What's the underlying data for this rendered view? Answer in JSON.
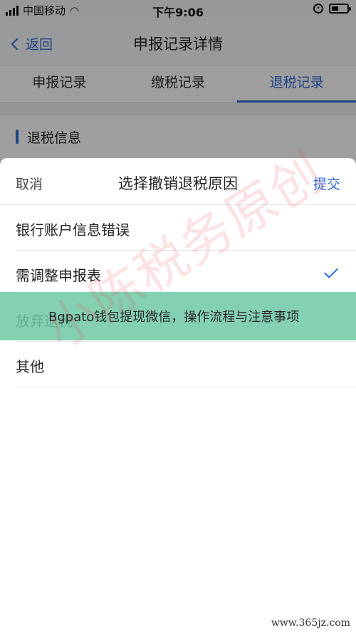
{
  "status_bar": {
    "carrier": "中国移动",
    "time": "下午9:06"
  },
  "nav": {
    "back_label": "返回",
    "title": "申报记录详情"
  },
  "tabs": [
    {
      "label": "申报记录",
      "active": false
    },
    {
      "label": "缴税记录",
      "active": false
    },
    {
      "label": "退税记录",
      "active": true
    }
  ],
  "section": {
    "title": "退税信息"
  },
  "sheet": {
    "cancel_label": "取消",
    "title": "选择撤销退税原因",
    "submit_label": "提交",
    "options": [
      {
        "label": "银行账户信息错误",
        "selected": false
      },
      {
        "label": "需调整申报表",
        "selected": true
      },
      {
        "label": "放弃退税",
        "selected": false
      },
      {
        "label": "其他",
        "selected": false
      }
    ]
  },
  "banner_text": "Bgpato钱包提现微信，操作流程与注意事项",
  "watermark_text": "小陈税务原创",
  "site_mark": "www.365jz.com",
  "colors": {
    "accent": "#2f6bd8",
    "banner": "#6ec8a5"
  }
}
